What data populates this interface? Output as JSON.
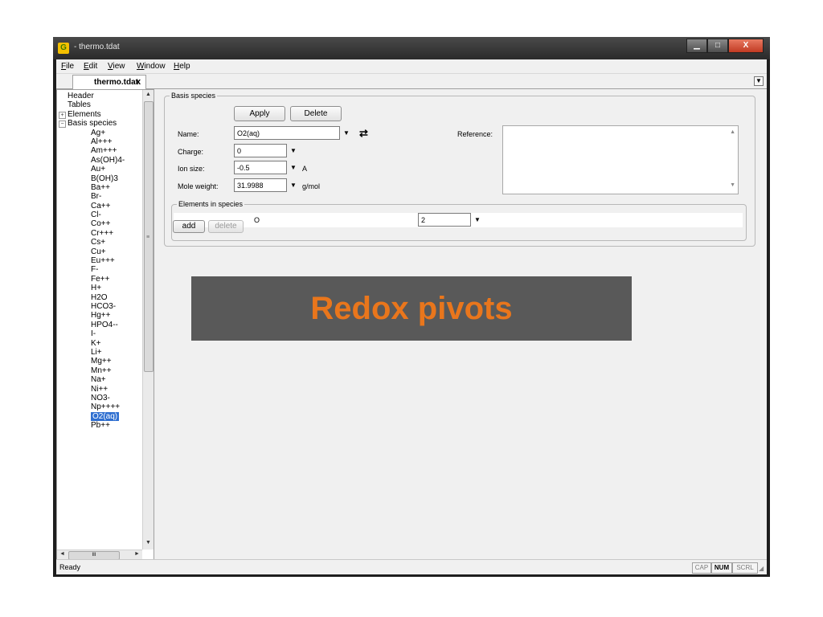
{
  "window": {
    "app_icon": "G",
    "title": "- thermo.tdat",
    "minimize": "▁",
    "maximize": "□",
    "close": "X"
  },
  "menubar": {
    "items": [
      {
        "u": "F",
        "rest": "ile"
      },
      {
        "u": "E",
        "rest": "dit"
      },
      {
        "u": "V",
        "rest": "iew"
      },
      {
        "u": "W",
        "rest": "indow"
      },
      {
        "u": "H",
        "rest": "elp"
      }
    ]
  },
  "tabs": {
    "active_label": "thermo.tdat",
    "close_glyph": "x",
    "dropdown_glyph": "▼"
  },
  "tree": {
    "items": [
      {
        "label": "Header",
        "level": 0
      },
      {
        "label": "Tables",
        "level": 0
      },
      {
        "label": "Elements",
        "level": 0,
        "expander": "+"
      },
      {
        "label": "Basis species",
        "level": 0,
        "expander": "−"
      },
      {
        "label": "Ag+",
        "level": 1
      },
      {
        "label": "Al+++",
        "level": 1
      },
      {
        "label": "Am+++",
        "level": 1
      },
      {
        "label": "As(OH)4-",
        "level": 1
      },
      {
        "label": "Au+",
        "level": 1
      },
      {
        "label": "B(OH)3",
        "level": 1
      },
      {
        "label": "Ba++",
        "level": 1
      },
      {
        "label": "Br-",
        "level": 1
      },
      {
        "label": "Ca++",
        "level": 1
      },
      {
        "label": "Cl-",
        "level": 1
      },
      {
        "label": "Co++",
        "level": 1
      },
      {
        "label": "Cr+++",
        "level": 1
      },
      {
        "label": "Cs+",
        "level": 1
      },
      {
        "label": "Cu+",
        "level": 1
      },
      {
        "label": "Eu+++",
        "level": 1
      },
      {
        "label": "F-",
        "level": 1
      },
      {
        "label": "Fe++",
        "level": 1
      },
      {
        "label": "H+",
        "level": 1
      },
      {
        "label": "H2O",
        "level": 1
      },
      {
        "label": "HCO3-",
        "level": 1
      },
      {
        "label": "Hg++",
        "level": 1
      },
      {
        "label": "HPO4--",
        "level": 1
      },
      {
        "label": "I-",
        "level": 1
      },
      {
        "label": "K+",
        "level": 1
      },
      {
        "label": "Li+",
        "level": 1
      },
      {
        "label": "Mg++",
        "level": 1
      },
      {
        "label": "Mn++",
        "level": 1
      },
      {
        "label": "Na+",
        "level": 1
      },
      {
        "label": "Ni++",
        "level": 1
      },
      {
        "label": "NO3-",
        "level": 1
      },
      {
        "label": "Np++++",
        "level": 1
      },
      {
        "label": "O2(aq)",
        "level": 1,
        "selected": true
      },
      {
        "label": "Pb++",
        "level": 1
      }
    ],
    "scroll_up": "▲",
    "scroll_down": "▼",
    "scroll_left": "◄",
    "scroll_right": "►",
    "vgrip": "≡",
    "hgrip": "III"
  },
  "basis_group": {
    "title": "Basis species",
    "apply_label": "Apply",
    "delete_label": "Delete",
    "name_label": "Name:",
    "name_value": "O2(aq)",
    "swap_glyph": "⇄",
    "charge_label": "Charge:",
    "charge_value": "0",
    "ion_size_label": "Ion size:",
    "ion_size_value": "-0.5",
    "ion_size_unit": "A",
    "mole_weight_label": "Mole weight:",
    "mole_weight_value": "31.9988",
    "mole_weight_unit": "g/mol",
    "reference_label": "Reference:",
    "reference_value": "",
    "dropdown_glyph": "▼",
    "scroll_up": "▲",
    "scroll_down": "▼"
  },
  "elements_group": {
    "title": "Elements in species",
    "rows": [
      {
        "element": "O",
        "count": "2"
      }
    ],
    "add_label": "add",
    "delete_label": "delete"
  },
  "overlay": {
    "text": "Redox pivots",
    "text_color": "#e9761c",
    "background": "#595959"
  },
  "statusbar": {
    "text": "Ready",
    "indicators": [
      {
        "label": "CAP",
        "active": false
      },
      {
        "label": "NUM",
        "active": true
      },
      {
        "label": "SCRL",
        "active": false
      }
    ]
  }
}
